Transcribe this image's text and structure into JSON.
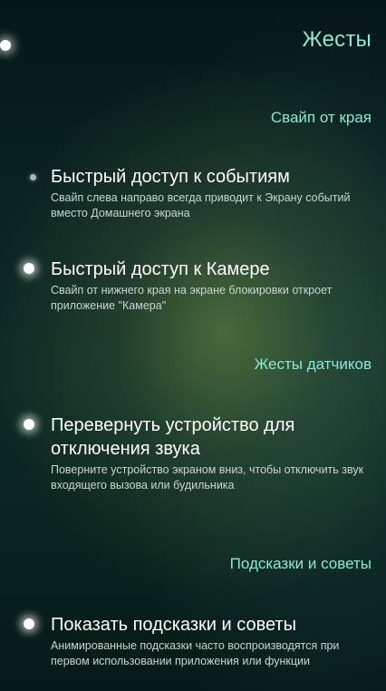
{
  "header": {
    "title": "Жесты"
  },
  "sections": [
    {
      "header": "Свайп от края",
      "items": [
        {
          "title": "Быстрый доступ к событиям",
          "description": "Свайп слева направо всегда приводит к Экрану событий вместо Домашнего экрана",
          "enabled": false
        },
        {
          "title": "Быстрый доступ к Камере",
          "description": "Свайп от нижнего края на экране блокировки откроет приложение \"Камера\"",
          "enabled": true
        }
      ]
    },
    {
      "header": "Жесты датчиков",
      "items": [
        {
          "title": "Перевернуть устройство для отключения звука",
          "description": "Поверните устройство экраном вниз, чтобы отключить звук входящего вызова или будильника",
          "enabled": true
        }
      ]
    },
    {
      "header": "Подсказки и советы",
      "items": [
        {
          "title": "Показать подсказки и советы",
          "description": "Анимированные подсказки часто воспроизводятся при первом использовании приложения или функции",
          "enabled": true
        }
      ]
    }
  ]
}
